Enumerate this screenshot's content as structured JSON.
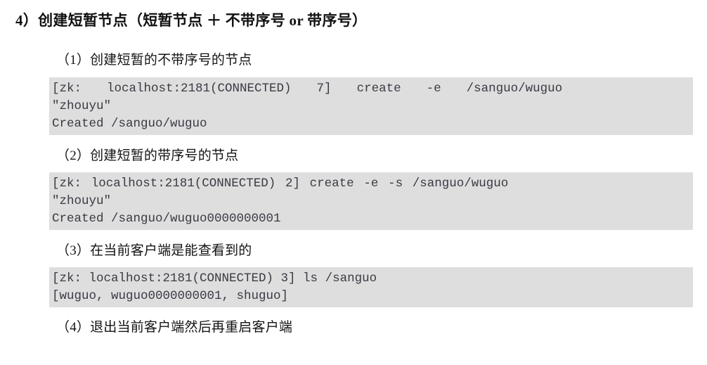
{
  "document": {
    "title": "4）创建短暂节点（短暂节点 ＋ 不带序号 or 带序号）",
    "background_color": "#ffffff",
    "code_background_color": "#dedede",
    "code_text_color": "#3a3a44"
  },
  "sections": [
    {
      "heading": "（1）创建短暂的不带序号的节点",
      "code": {
        "lines": [
          "[zk:  localhost:2181(CONNECTED)  7]  create  -e  /sanguo/wuguo",
          "\"zhouyu\"",
          "Created /sanguo/wuguo"
        ]
      }
    },
    {
      "heading": "（2）创建短暂的带序号的节点",
      "code": {
        "lines": [
          "[zk: localhost:2181(CONNECTED) 2] create -e -s /sanguo/wuguo",
          "\"zhouyu\"",
          "Created /sanguo/wuguo0000000001"
        ]
      }
    },
    {
      "heading": "（3）在当前客户端是能查看到的",
      "code": {
        "lines": [
          "[zk: localhost:2181(CONNECTED) 3] ls /sanguo",
          "[wuguo, wuguo0000000001, shuguo]"
        ]
      }
    },
    {
      "heading": "（4）退出当前客户端然后再重启客户端",
      "code": null
    }
  ]
}
